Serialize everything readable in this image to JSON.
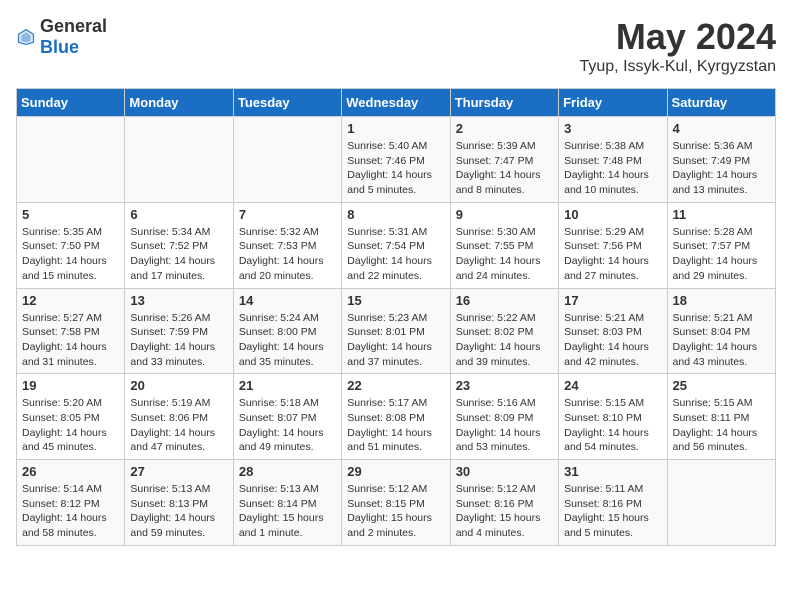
{
  "header": {
    "logo_general": "General",
    "logo_blue": "Blue",
    "month_title": "May 2024",
    "location": "Tyup, Issyk-Kul, Kyrgyzstan"
  },
  "days_of_week": [
    "Sunday",
    "Monday",
    "Tuesday",
    "Wednesday",
    "Thursday",
    "Friday",
    "Saturday"
  ],
  "weeks": [
    {
      "days": [
        {
          "num": "",
          "info": ""
        },
        {
          "num": "",
          "info": ""
        },
        {
          "num": "",
          "info": ""
        },
        {
          "num": "1",
          "info": "Sunrise: 5:40 AM\nSunset: 7:46 PM\nDaylight: 14 hours\nand 5 minutes."
        },
        {
          "num": "2",
          "info": "Sunrise: 5:39 AM\nSunset: 7:47 PM\nDaylight: 14 hours\nand 8 minutes."
        },
        {
          "num": "3",
          "info": "Sunrise: 5:38 AM\nSunset: 7:48 PM\nDaylight: 14 hours\nand 10 minutes."
        },
        {
          "num": "4",
          "info": "Sunrise: 5:36 AM\nSunset: 7:49 PM\nDaylight: 14 hours\nand 13 minutes."
        }
      ]
    },
    {
      "days": [
        {
          "num": "5",
          "info": "Sunrise: 5:35 AM\nSunset: 7:50 PM\nDaylight: 14 hours\nand 15 minutes."
        },
        {
          "num": "6",
          "info": "Sunrise: 5:34 AM\nSunset: 7:52 PM\nDaylight: 14 hours\nand 17 minutes."
        },
        {
          "num": "7",
          "info": "Sunrise: 5:32 AM\nSunset: 7:53 PM\nDaylight: 14 hours\nand 20 minutes."
        },
        {
          "num": "8",
          "info": "Sunrise: 5:31 AM\nSunset: 7:54 PM\nDaylight: 14 hours\nand 22 minutes."
        },
        {
          "num": "9",
          "info": "Sunrise: 5:30 AM\nSunset: 7:55 PM\nDaylight: 14 hours\nand 24 minutes."
        },
        {
          "num": "10",
          "info": "Sunrise: 5:29 AM\nSunset: 7:56 PM\nDaylight: 14 hours\nand 27 minutes."
        },
        {
          "num": "11",
          "info": "Sunrise: 5:28 AM\nSunset: 7:57 PM\nDaylight: 14 hours\nand 29 minutes."
        }
      ]
    },
    {
      "days": [
        {
          "num": "12",
          "info": "Sunrise: 5:27 AM\nSunset: 7:58 PM\nDaylight: 14 hours\nand 31 minutes."
        },
        {
          "num": "13",
          "info": "Sunrise: 5:26 AM\nSunset: 7:59 PM\nDaylight: 14 hours\nand 33 minutes."
        },
        {
          "num": "14",
          "info": "Sunrise: 5:24 AM\nSunset: 8:00 PM\nDaylight: 14 hours\nand 35 minutes."
        },
        {
          "num": "15",
          "info": "Sunrise: 5:23 AM\nSunset: 8:01 PM\nDaylight: 14 hours\nand 37 minutes."
        },
        {
          "num": "16",
          "info": "Sunrise: 5:22 AM\nSunset: 8:02 PM\nDaylight: 14 hours\nand 39 minutes."
        },
        {
          "num": "17",
          "info": "Sunrise: 5:21 AM\nSunset: 8:03 PM\nDaylight: 14 hours\nand 42 minutes."
        },
        {
          "num": "18",
          "info": "Sunrise: 5:21 AM\nSunset: 8:04 PM\nDaylight: 14 hours\nand 43 minutes."
        }
      ]
    },
    {
      "days": [
        {
          "num": "19",
          "info": "Sunrise: 5:20 AM\nSunset: 8:05 PM\nDaylight: 14 hours\nand 45 minutes."
        },
        {
          "num": "20",
          "info": "Sunrise: 5:19 AM\nSunset: 8:06 PM\nDaylight: 14 hours\nand 47 minutes."
        },
        {
          "num": "21",
          "info": "Sunrise: 5:18 AM\nSunset: 8:07 PM\nDaylight: 14 hours\nand 49 minutes."
        },
        {
          "num": "22",
          "info": "Sunrise: 5:17 AM\nSunset: 8:08 PM\nDaylight: 14 hours\nand 51 minutes."
        },
        {
          "num": "23",
          "info": "Sunrise: 5:16 AM\nSunset: 8:09 PM\nDaylight: 14 hours\nand 53 minutes."
        },
        {
          "num": "24",
          "info": "Sunrise: 5:15 AM\nSunset: 8:10 PM\nDaylight: 14 hours\nand 54 minutes."
        },
        {
          "num": "25",
          "info": "Sunrise: 5:15 AM\nSunset: 8:11 PM\nDaylight: 14 hours\nand 56 minutes."
        }
      ]
    },
    {
      "days": [
        {
          "num": "26",
          "info": "Sunrise: 5:14 AM\nSunset: 8:12 PM\nDaylight: 14 hours\nand 58 minutes."
        },
        {
          "num": "27",
          "info": "Sunrise: 5:13 AM\nSunset: 8:13 PM\nDaylight: 14 hours\nand 59 minutes."
        },
        {
          "num": "28",
          "info": "Sunrise: 5:13 AM\nSunset: 8:14 PM\nDaylight: 15 hours\nand 1 minute."
        },
        {
          "num": "29",
          "info": "Sunrise: 5:12 AM\nSunset: 8:15 PM\nDaylight: 15 hours\nand 2 minutes."
        },
        {
          "num": "30",
          "info": "Sunrise: 5:12 AM\nSunset: 8:16 PM\nDaylight: 15 hours\nand 4 minutes."
        },
        {
          "num": "31",
          "info": "Sunrise: 5:11 AM\nSunset: 8:16 PM\nDaylight: 15 hours\nand 5 minutes."
        },
        {
          "num": "",
          "info": ""
        }
      ]
    }
  ]
}
